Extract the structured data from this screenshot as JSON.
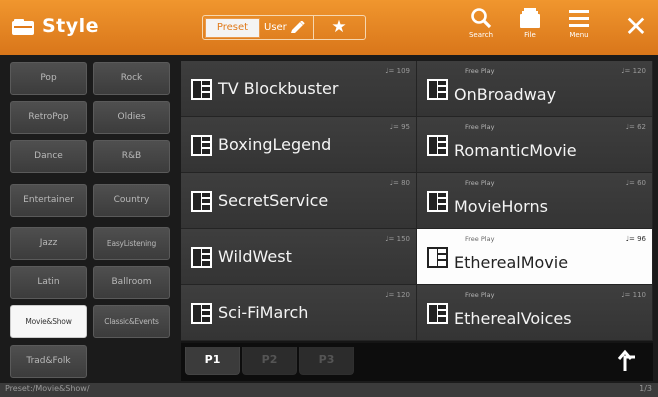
{
  "header": {
    "title": "Style",
    "title_icon": "folder-icon",
    "tabs": {
      "preset": "Preset",
      "user": "User",
      "favorite": "★"
    },
    "tools": [
      {
        "label": "Search",
        "icon": "search-icon"
      },
      {
        "label": "File",
        "icon": "file-icon"
      },
      {
        "label": "Menu",
        "icon": "menu-icon"
      }
    ],
    "close": "✕"
  },
  "categories": [
    "Pop",
    "Rock",
    "RetroPop",
    "Oldies",
    "Dance",
    "R&B",
    "Entertainer",
    "Country",
    "Jazz",
    "EasyListening",
    "Latin",
    "Ballroom",
    "Movie&Show",
    "Classic&Events",
    "Trad&Folk"
  ],
  "selected_category": "Movie&Show",
  "styles": [
    {
      "name": "TV Blockbuster",
      "tempo": "♩= 109",
      "subcategory": ""
    },
    {
      "name": "OnBroadway",
      "tempo": "♩= 120",
      "subcategory": "Free Play"
    },
    {
      "name": "BoxingLegend",
      "tempo": "♩= 95",
      "subcategory": ""
    },
    {
      "name": "RomanticMovie",
      "tempo": "♩= 62",
      "subcategory": "Free Play"
    },
    {
      "name": "SecretService",
      "tempo": "♩= 80",
      "subcategory": ""
    },
    {
      "name": "MovieHorns",
      "tempo": "♩= 60",
      "subcategory": "Free Play"
    },
    {
      "name": "WildWest",
      "tempo": "♩= 150",
      "subcategory": ""
    },
    {
      "name": "EtherealMovie",
      "tempo": "♩= 96",
      "subcategory": "Free Play"
    },
    {
      "name": "Sci-FiMarch",
      "tempo": "♩= 120",
      "subcategory": ""
    },
    {
      "name": "EtherealVoices",
      "tempo": "♩= 110",
      "subcategory": "Free Play"
    }
  ],
  "selected_style": "EtherealMovie",
  "pages": [
    "P1",
    "P2",
    "P3"
  ],
  "active_page": "P1",
  "up_button": "⮤",
  "status": {
    "path": "Preset:/Movie&Show/",
    "page_info": "1/3"
  },
  "colors": {
    "header": "#e7862a",
    "selected": "#fdfdfd",
    "background": "#1b1b1b"
  }
}
